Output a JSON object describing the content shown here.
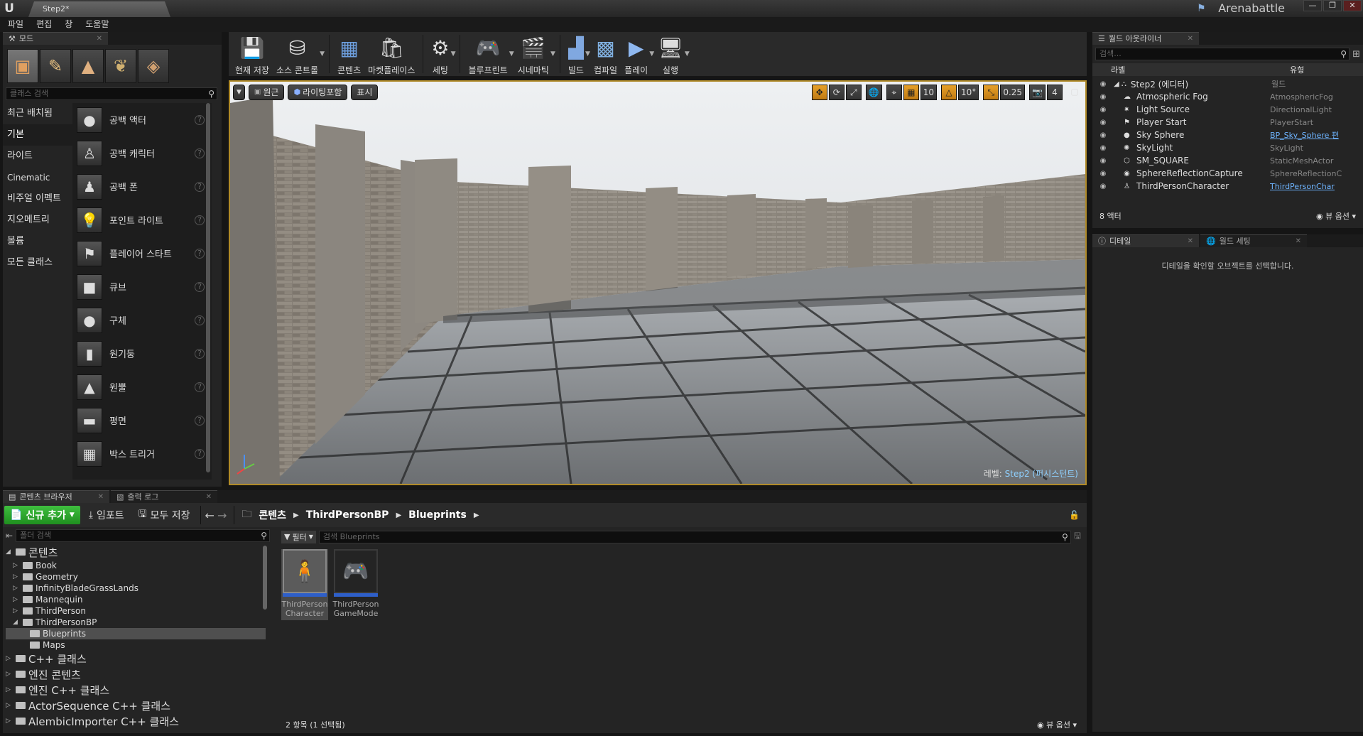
{
  "titlebar": {
    "doc_tab": "Step2*",
    "project": "Arenabattle",
    "win_buttons": [
      "—",
      "❐",
      "✕"
    ]
  },
  "menu": [
    "파일",
    "편집",
    "창",
    "도움말"
  ],
  "modes": {
    "tab": "모드",
    "search_placeholder": "클래스 검색",
    "categories": [
      "최근 배치됨",
      "기본",
      "라이트",
      "Cinematic",
      "비주얼 이펙트",
      "지오메트리",
      "볼륨",
      "모든 클래스"
    ],
    "items": [
      "공백 액터",
      "공백 캐릭터",
      "공백 폰",
      "포인트 라이트",
      "플레이어 스타트",
      "큐브",
      "구체",
      "원기둥",
      "원뿔",
      "평면",
      "박스 트리거"
    ]
  },
  "toolbar": [
    "현재 저장",
    "소스 콘트롤",
    "콘텐츠",
    "마켓플레이스",
    "세팅",
    "블루프린트",
    "시네마틱",
    "빌드",
    "컴파일",
    "플레이",
    "실행"
  ],
  "viewport": {
    "perspective": "원근",
    "lighting": "라이팅포함",
    "show": "표시",
    "grid_snap": "10",
    "rot_snap": "10°",
    "scale_snap": "0.25",
    "cam_speed": "4",
    "level_prefix": "레벨:",
    "level_name": "Step2 (퍼시스턴트)"
  },
  "outliner": {
    "tab": "월드 아웃라이너",
    "search_placeholder": "검색...",
    "col_label": "라벨",
    "col_type": "유형",
    "root": {
      "name": "Step2 (에디터)",
      "type": "월드"
    },
    "rows": [
      {
        "name": "Atmospheric Fog",
        "type": "AtmosphericFog",
        "link": false,
        "icon": "☁"
      },
      {
        "name": "Light Source",
        "type": "DirectionalLight",
        "link": false,
        "icon": "✷"
      },
      {
        "name": "Player Start",
        "type": "PlayerStart",
        "link": false,
        "icon": "⚑"
      },
      {
        "name": "Sky Sphere",
        "type": "BP_Sky_Sphere 편",
        "link": true,
        "icon": "●"
      },
      {
        "name": "SkyLight",
        "type": "SkyLight",
        "link": false,
        "icon": "✺"
      },
      {
        "name": "SM_SQUARE",
        "type": "StaticMeshActor",
        "link": false,
        "icon": "⬡"
      },
      {
        "name": "SphereReflectionCapture",
        "type": "SphereReflectionC",
        "link": false,
        "icon": "◉"
      },
      {
        "name": "ThirdPersonCharacter",
        "type": "ThirdPersonChar",
        "link": true,
        "icon": "♙"
      }
    ],
    "count": "8 액터",
    "view_options": "뷰 옵션"
  },
  "details": {
    "tab_details": "디테일",
    "tab_world": "월드 세팅",
    "empty": "디테일을 확인할 오브젝트를 선택합니다."
  },
  "cbrowser": {
    "tab": "콘텐츠 브라우저",
    "tab_log": "출력 로그",
    "add_new": "신규 추가",
    "import": "임포트",
    "save_all": "모두 저장",
    "crumbs": [
      "콘텐츠",
      "ThirdPersonBP",
      "Blueprints"
    ],
    "folder_search": "폴더 검색",
    "filter": "필터",
    "asset_search": "검색 Blueprints",
    "tree": [
      {
        "label": "콘텐츠",
        "depth": 0,
        "big": true,
        "open": true
      },
      {
        "label": "Book",
        "depth": 1
      },
      {
        "label": "Geometry",
        "depth": 1
      },
      {
        "label": "InfinityBladeGrassLands",
        "depth": 1
      },
      {
        "label": "Mannequin",
        "depth": 1
      },
      {
        "label": "ThirdPerson",
        "depth": 1
      },
      {
        "label": "ThirdPersonBP",
        "depth": 1,
        "open": true
      },
      {
        "label": "Blueprints",
        "depth": 2,
        "sel": true,
        "noarrow": true
      },
      {
        "label": "Maps",
        "depth": 2,
        "noarrow": true
      },
      {
        "label": "C++ 클래스",
        "depth": 0,
        "big": true
      },
      {
        "label": "엔진 콘텐츠",
        "depth": 0,
        "big": true
      },
      {
        "label": "엔진 C++ 클래스",
        "depth": 0,
        "big": true
      },
      {
        "label": "ActorSequence C++ 클래스",
        "depth": 0,
        "big": true
      },
      {
        "label": "AlembicImporter C++ 클래스",
        "depth": 0,
        "big": true
      }
    ],
    "assets": [
      {
        "line1": "ThirdPerson",
        "line2": "Character",
        "icon": "🧍",
        "sel": true
      },
      {
        "line1": "ThirdPerson",
        "line2": "GameMode",
        "icon": "🎮",
        "sel": false
      }
    ],
    "status": "2 항목 (1 선택됨)",
    "view_options": "뷰 옵션"
  }
}
